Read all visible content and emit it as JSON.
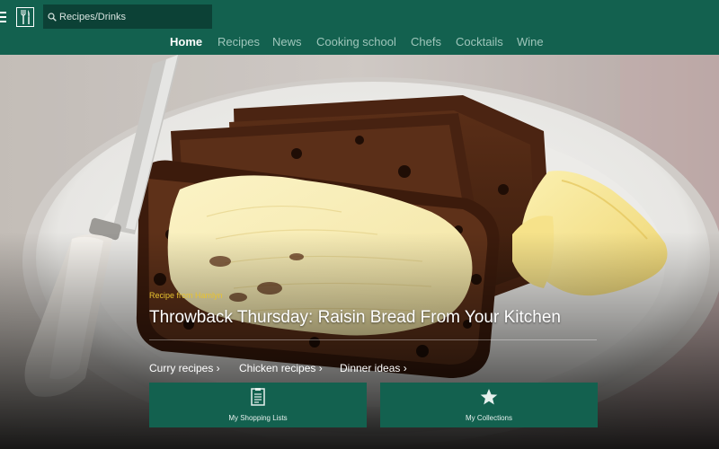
{
  "header": {
    "search": {
      "value": "Recipes/Drinks"
    },
    "nav": [
      {
        "label": "Home",
        "active": true
      },
      {
        "label": "Recipes",
        "active": false
      },
      {
        "label": "News",
        "active": false
      },
      {
        "label": "Cooking school",
        "active": false
      },
      {
        "label": "Chefs",
        "active": false
      },
      {
        "label": "Cocktails",
        "active": false
      },
      {
        "label": "Wine",
        "active": false
      }
    ]
  },
  "hero": {
    "source": "Recipe from Hamlyn",
    "title": "Throwback Thursday: Raisin Bread From Your Kitchen",
    "quick_links": [
      {
        "label": "Curry recipes ›"
      },
      {
        "label": "Chicken recipes ›"
      },
      {
        "label": "Dinner ideas ›"
      }
    ]
  },
  "tiles": [
    {
      "label": "My Shopping Lists",
      "icon": "shopping-list-icon"
    },
    {
      "label": "My Collections",
      "icon": "star-icon"
    }
  ],
  "colors": {
    "brand": "#13614f",
    "search_bg": "#0c4136",
    "nav_inactive": "#9fc6bb",
    "source_label": "#e8c330"
  }
}
